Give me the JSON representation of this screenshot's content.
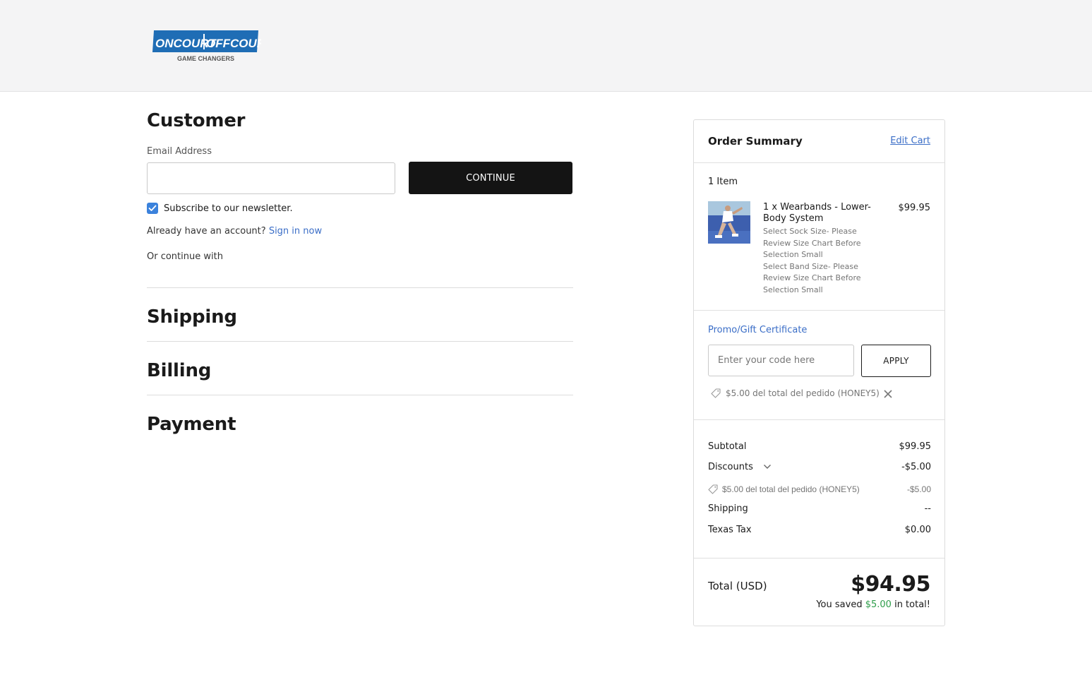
{
  "brand": {
    "logo_left": "ONCOURT",
    "logo_right": "OFFCOURT",
    "logo_tagline": "GAME CHANGERS",
    "logo_color": "#1f6db5"
  },
  "customer": {
    "title": "Customer",
    "email_label": "Email Address",
    "email_value": "",
    "continue_label": "CONTINUE",
    "newsletter_label": "Subscribe to our newsletter.",
    "newsletter_checked": true,
    "already_text": "Already have an account?",
    "sign_in_label": "Sign in now",
    "or_continue": "Or continue with"
  },
  "sections": {
    "shipping": "Shipping",
    "billing": "Billing",
    "payment": "Payment"
  },
  "summary": {
    "title": "Order Summary",
    "edit_cart": "Edit Cart",
    "items_count": "1 Item",
    "product": {
      "name": "1 x Wearbands - Lower-Body System",
      "price": "$99.95",
      "options": [
        "Select Sock Size- Please Review Size Chart Before Selection Small",
        "Select Band Size- Please Review Size Chart Before Selection Small"
      ]
    },
    "promo": {
      "label": "Promo/Gift Certificate",
      "placeholder": "Enter your code here",
      "apply_label": "APPLY",
      "applied_coupon": "$5.00 del total del pedido (HONEY5)"
    },
    "lines": {
      "subtotal_label": "Subtotal",
      "subtotal_value": "$99.95",
      "discounts_label": "Discounts",
      "discounts_value": "-$5.00",
      "discount_detail_label": "$5.00 del total del pedido (HONEY5)",
      "discount_detail_value": "-$5.00",
      "shipping_label": "Shipping",
      "shipping_value": "--",
      "tax_label": "Texas Tax",
      "tax_value": "$0.00"
    },
    "total": {
      "label": "Total (USD)",
      "amount": "$94.95",
      "saved_prefix": "You saved",
      "saved_amount": "$5.00",
      "saved_suffix": "in total!"
    }
  },
  "colors": {
    "accent_link": "#3b6ec7",
    "checkbox": "#3b82dc",
    "primary_button": "#141414",
    "savings_green": "#2e9d4a"
  }
}
